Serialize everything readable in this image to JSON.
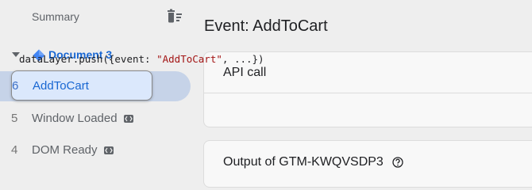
{
  "sidebar": {
    "summary_label": "Summary",
    "delete_icon": "delete-sweep-icon",
    "document": {
      "label": "Document 3",
      "icon": "diamond-icon",
      "caret_icon": "caret-down-icon"
    },
    "events": [
      {
        "number": "6",
        "label": "AddToCart",
        "selected": true
      },
      {
        "number": "5",
        "label": "Window Loaded",
        "icon": "code-icon"
      },
      {
        "number": "4",
        "label": "DOM Ready",
        "icon": "code-icon"
      }
    ]
  },
  "main": {
    "title": "Event: AddToCart",
    "api_card": {
      "heading": "API call",
      "code_prefix": "dataLayer.push({event: ",
      "code_string": "\"AddToCart\"",
      "code_suffix": ", ...})"
    },
    "output_card": {
      "heading": "Output of GTM-KWQVSDP3",
      "icon": "help-icon"
    }
  },
  "colors": {
    "accent": "#1967d2",
    "selection_bg": "#dbe8fc",
    "track_bg": "#c6d3e8",
    "string": "#a31515"
  }
}
